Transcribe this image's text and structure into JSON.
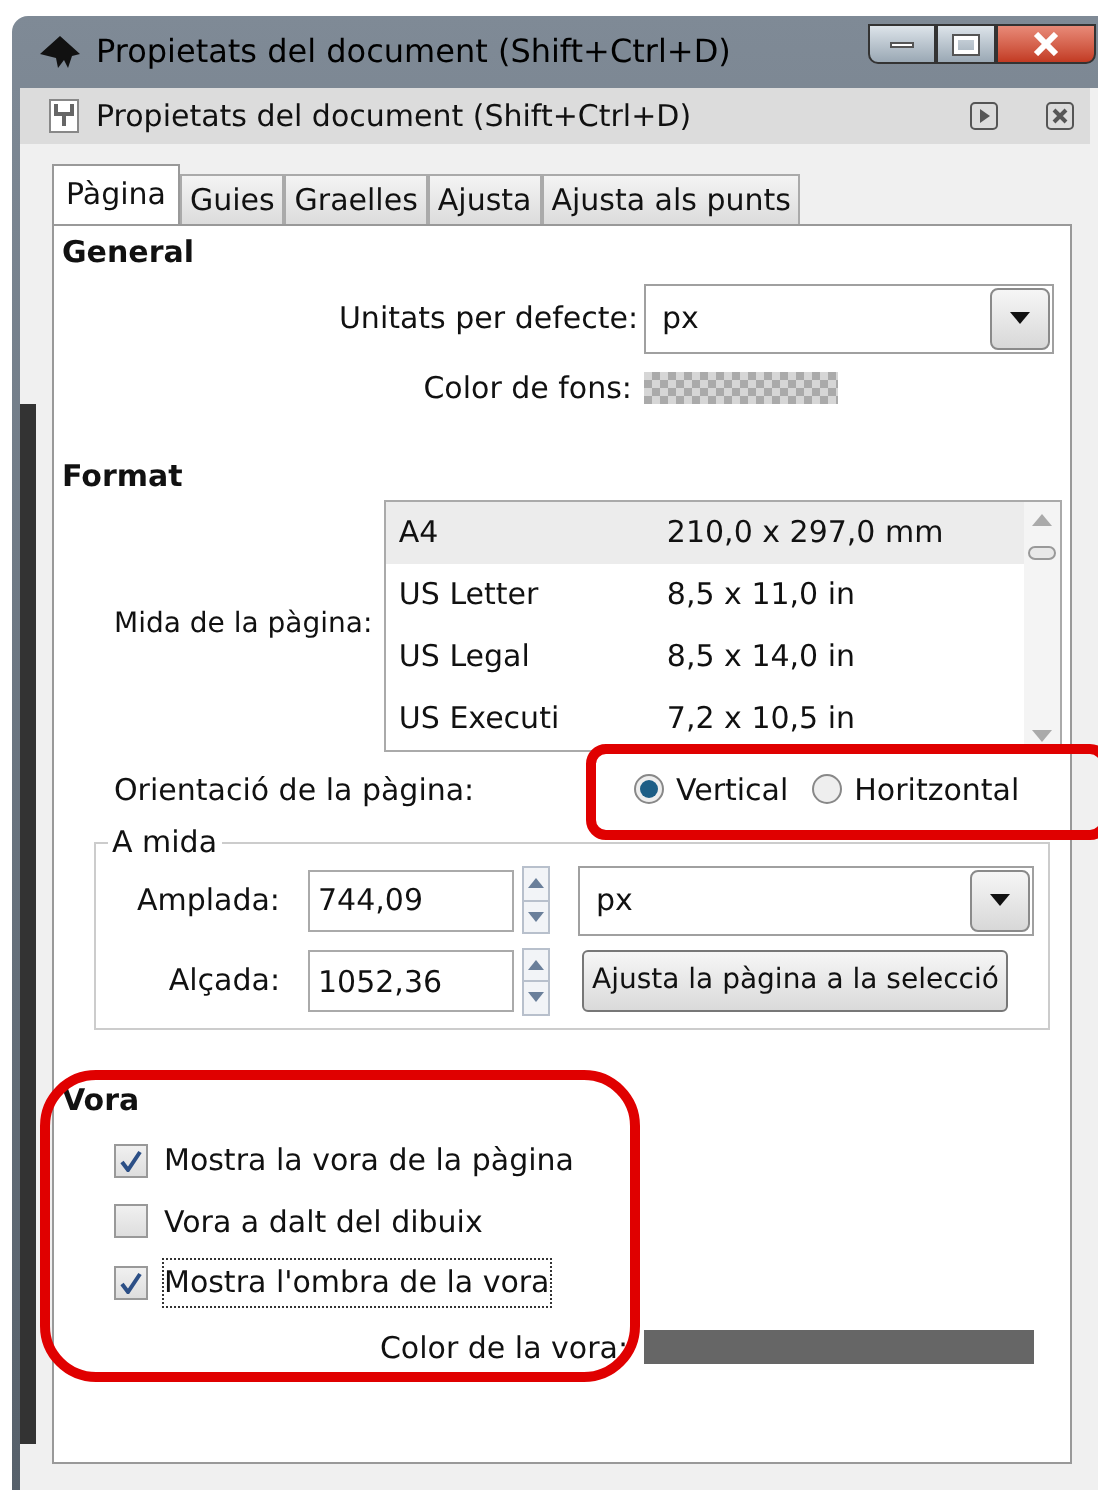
{
  "window": {
    "title": "Propietats del document (Shift+Ctrl+D)"
  },
  "dock": {
    "title": "Propietats del document (Shift+Ctrl+D)"
  },
  "tabs": [
    {
      "label": "Pàgina",
      "selected": true
    },
    {
      "label": "Guies",
      "selected": false
    },
    {
      "label": "Graelles",
      "selected": false
    },
    {
      "label": "Ajusta",
      "selected": false
    },
    {
      "label": "Ajusta als punts",
      "selected": false
    }
  ],
  "general": {
    "heading": "General",
    "units": {
      "label": "Unitats per defecte:",
      "value": "px"
    },
    "background": {
      "label": "Color de fons:"
    }
  },
  "format": {
    "heading": "Format",
    "page_size": {
      "label": "Mida de la pàgina:",
      "sizes": [
        {
          "name": "A4",
          "dims": "210,0 x 297,0 mm",
          "selected": true
        },
        {
          "name": "US Letter",
          "dims": "8,5 x 11,0 in",
          "selected": false
        },
        {
          "name": "US Legal",
          "dims": "8,5 x 14,0 in",
          "selected": false
        },
        {
          "name": "US Executi",
          "dims": "7,2 x 10,5 in",
          "selected": false
        }
      ]
    },
    "orientation": {
      "label": "Orientació de la pàgina:",
      "options": [
        {
          "label": "Vertical",
          "selected": true
        },
        {
          "label": "Horitzontal",
          "selected": false
        }
      ]
    },
    "custom": {
      "legend": "A mida",
      "width": {
        "label": "Amplada:",
        "value": "744,09"
      },
      "height": {
        "label": "Alçada:",
        "value": "1052,36"
      },
      "units": "px",
      "fit_button": "Ajusta la pàgina a la selecció"
    }
  },
  "border": {
    "heading": "Vora",
    "checkboxes": [
      {
        "label": "Mostra la vora de la pàgina",
        "checked": true,
        "focused": false
      },
      {
        "label": "Vora a dalt del dibuix",
        "checked": false,
        "focused": false
      },
      {
        "label": "Mostra l'ombra de la vora",
        "checked": true,
        "focused": true
      }
    ],
    "color_label": "Color de la vora:"
  }
}
